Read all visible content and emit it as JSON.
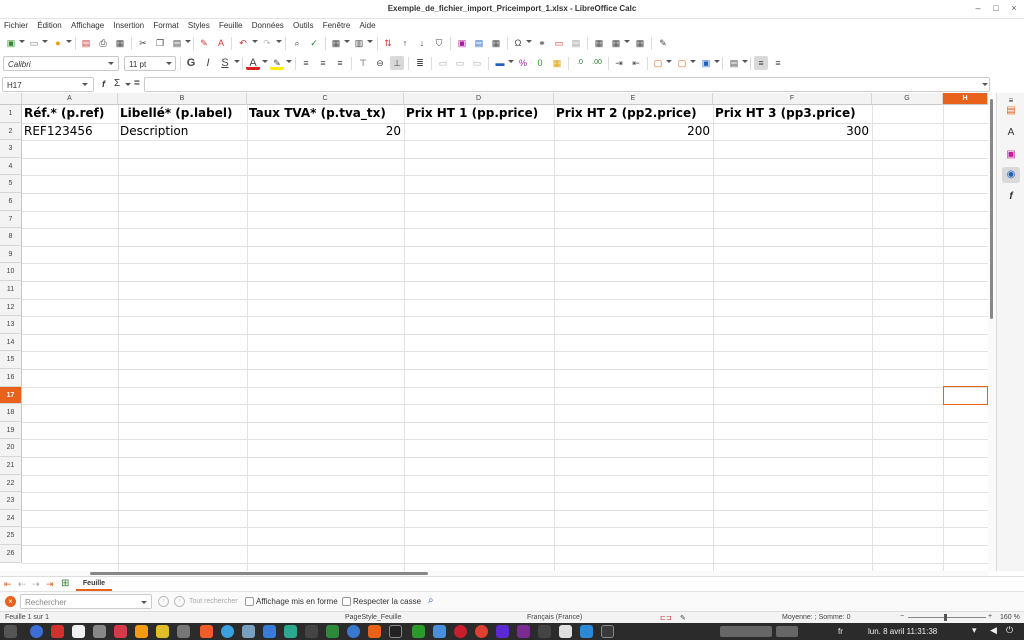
{
  "window": {
    "title": "Exemple_de_fichier_import_Priceimport_1.xlsx - LibreOffice Calc",
    "minimize": "–",
    "maximize": "□",
    "close": "×"
  },
  "menu": [
    "Fichier",
    "Édition",
    "Affichage",
    "Insertion",
    "Format",
    "Styles",
    "Feuille",
    "Données",
    "Outils",
    "Fenêtre",
    "Aide"
  ],
  "format_toolbar": {
    "font_name": "Calibri",
    "font_size": "11 pt",
    "bold_icon": "G",
    "italic_icon": "I",
    "underline_icon": "S",
    "font_color_icon": "A",
    "font_color": "#e02020",
    "highlight_color": "#ffee00"
  },
  "formula_bar": {
    "name_box": "H17",
    "function_icon": "f",
    "sum_icon": "Σ",
    "equals_icon": "=",
    "content": ""
  },
  "columns": [
    "A",
    "B",
    "C",
    "D",
    "E",
    "F",
    "G",
    "H"
  ],
  "active_cell": "H17",
  "rows": [
    "1",
    "2",
    "3",
    "4",
    "5",
    "6",
    "7",
    "8",
    "9",
    "10",
    "11",
    "12",
    "13",
    "14",
    "15",
    "16",
    "17",
    "18",
    "19",
    "20",
    "21",
    "22",
    "23",
    "24",
    "25",
    "26"
  ],
  "cells": {
    "A1": "Réf.* (p.ref)",
    "B1": "Libellé* (p.label)",
    "C1": "Taux TVA* (p.tva_tx)",
    "D1": "Prix HT 1 (pp.price)",
    "E1": "Prix HT 2 (pp2.price)",
    "F1": "Prix HT 3 (pp3.price)",
    "A2": "REF123456",
    "B2": "Description",
    "C2": "20",
    "E2": "200",
    "F2": "300"
  },
  "sheet_tabs": {
    "active": "Feuille"
  },
  "find_bar": {
    "placeholder": "Rechercher",
    "find_all": "Tout rechercher",
    "formatted_display": "Affichage mis en forme",
    "match_case": "Respecter la casse"
  },
  "status_bar": {
    "sheet_pos": "Feuille 1 sur 1",
    "page_style": "PageStyle_Feuille",
    "language": "Français (France)",
    "stats": "Moyenne: ; Somme: 0",
    "zoom": "160 %"
  },
  "taskbar": {
    "lang": "fr",
    "datetime": "lun. 8 avril  11:31:38"
  },
  "colors": {
    "accent": "#e9621b",
    "header_bg": "#f3f3f3",
    "taskbar_bg": "#2b2b2b"
  }
}
